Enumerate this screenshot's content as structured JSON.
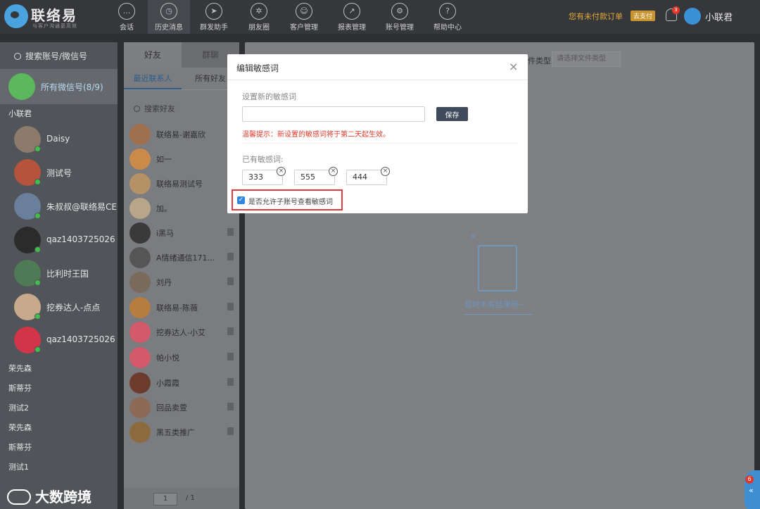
{
  "app": {
    "name": "联络易",
    "tagline": "与客户沟通更高效"
  },
  "nav": [
    {
      "label": "会话",
      "icon": "chat-icon",
      "glyph": "…"
    },
    {
      "label": "历史消息",
      "icon": "clock-icon",
      "glyph": "◷"
    },
    {
      "label": "群发助手",
      "icon": "send-icon",
      "glyph": "➤"
    },
    {
      "label": "朋友圈",
      "icon": "aperture-icon",
      "glyph": "✲"
    },
    {
      "label": "客户管理",
      "icon": "customer-icon",
      "glyph": "☺"
    },
    {
      "label": "报表管理",
      "icon": "report-icon",
      "glyph": "↗"
    },
    {
      "label": "账号管理",
      "icon": "gear-icon",
      "glyph": "⚙"
    },
    {
      "label": "帮助中心",
      "icon": "help-icon",
      "glyph": "?"
    }
  ],
  "header": {
    "unpaid_text": "您有未付款订单",
    "unpaid_badge": "去支付",
    "notification_count": "3",
    "user_name": "小联君"
  },
  "accounts": {
    "search_placeholder": "搜索账号/微信号",
    "all_label": "所有微信号(8/9)",
    "group_name": "小联君",
    "items": [
      {
        "name": "Daisy",
        "color": "#8c7a6b"
      },
      {
        "name": "测试号",
        "color": "#b5533c"
      },
      {
        "name": "朱叔叔@联络易CE",
        "color": "#6a7f9b"
      },
      {
        "name": "qaz1403725026",
        "color": "#2b2b2b"
      },
      {
        "name": "比利时王国",
        "color": "#4f7a56"
      },
      {
        "name": "挖券达人-点点",
        "color": "#c7a98b"
      },
      {
        "name": "qaz1403725026",
        "color": "#d2344a"
      }
    ],
    "others": [
      "荣先森",
      "斯蒂芬",
      "测试2",
      "荣先森",
      "斯蒂芬",
      "测试1"
    ]
  },
  "friends": {
    "tab_friends": "好友",
    "tab_groups": "群聊",
    "sub_recent": "最近联系人",
    "sub_all": "所有好友",
    "search_placeholder": "搜索好友",
    "items": [
      {
        "name": "联络易-谢嘉欣",
        "color": "#a0704e"
      },
      {
        "name": "如一",
        "color": "#c98a4a"
      },
      {
        "name": "联络易测试号",
        "color": "#b59166"
      },
      {
        "name": "加。",
        "color": "#b9a58a"
      },
      {
        "name": "i黑马",
        "color": "#3a3a3a"
      },
      {
        "name": "A情绪通信171...",
        "color": "#555555"
      },
      {
        "name": "刘丹",
        "color": "#7a6a5c"
      },
      {
        "name": "联络易-陈薇",
        "color": "#b77d3e"
      },
      {
        "name": "挖券达人-小艾",
        "color": "#d25a6a"
      },
      {
        "name": "帕小悦",
        "color": "#d25a6a"
      },
      {
        "name": "小霞霞",
        "color": "#6d3b2c"
      },
      {
        "name": "回品卖萱",
        "color": "#8d6a58"
      },
      {
        "name": "黑五类推广",
        "color": "#8c6a3e"
      }
    ],
    "page_current": "1",
    "page_total": "/ 1"
  },
  "content": {
    "file_type_label": "件类型",
    "file_type_placeholder": "请选择文件类型",
    "empty_text": "暂时木有结果呀~"
  },
  "modal": {
    "title": "编辑敏感词",
    "close": "×",
    "new_word_label": "设置新的敏感词",
    "new_word_value": "",
    "save_label": "保存",
    "tip": "温馨提示：新设置的敏感词将于第二天起生效。",
    "existing_label": "已有敏感词:",
    "words": [
      "333",
      "555",
      "444"
    ],
    "allow_label": "是否允许子账号查看敏感词",
    "allow_checked": true
  },
  "watermark": "大数跨境",
  "float_count": "6"
}
